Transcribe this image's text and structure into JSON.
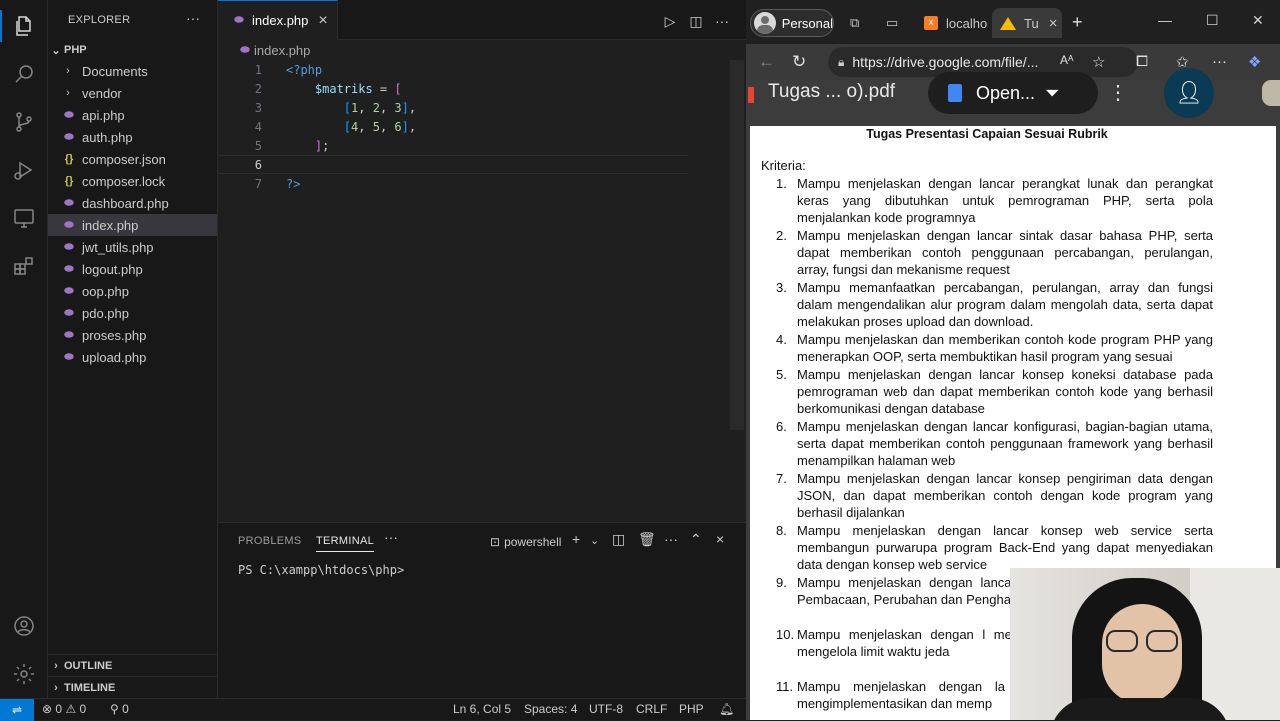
{
  "vscode": {
    "explorer_title": "EXPLORER",
    "more_glyph": "···",
    "root_folder": "PHP",
    "tree": [
      {
        "label": "Documents",
        "kind": "folder"
      },
      {
        "label": "vendor",
        "kind": "folder"
      },
      {
        "label": "api.php",
        "kind": "php"
      },
      {
        "label": "auth.php",
        "kind": "php"
      },
      {
        "label": "composer.json",
        "kind": "json"
      },
      {
        "label": "composer.lock",
        "kind": "json"
      },
      {
        "label": "dashboard.php",
        "kind": "php"
      },
      {
        "label": "index.php",
        "kind": "php",
        "selected": true
      },
      {
        "label": "jwt_utils.php",
        "kind": "php"
      },
      {
        "label": "logout.php",
        "kind": "php"
      },
      {
        "label": "oop.php",
        "kind": "php"
      },
      {
        "label": "pdo.php",
        "kind": "php"
      },
      {
        "label": "proses.php",
        "kind": "php"
      },
      {
        "label": "upload.php",
        "kind": "php"
      }
    ],
    "outline_label": "OUTLINE",
    "timeline_label": "TIMELINE",
    "tab_label": "index.php",
    "breadcrumb": "index.php",
    "code_lines": [
      {
        "n": "1",
        "text": "<?php"
      },
      {
        "n": "2",
        "text": "    $matriks = ["
      },
      {
        "n": "3",
        "text": "        [1, 2, 3],"
      },
      {
        "n": "4",
        "text": "        [4, 5, 6],"
      },
      {
        "n": "5",
        "text": "    ];"
      },
      {
        "n": "6",
        "text": ""
      },
      {
        "n": "7",
        "text": "?>"
      }
    ],
    "panel": {
      "tabs": [
        "PROBLEMS",
        "TERMINAL"
      ],
      "active_tab": "TERMINAL",
      "shell": "powershell",
      "prompt": "PS C:\\xampp\\htdocs\\php>"
    },
    "status": {
      "errors": "0",
      "warnings": "0",
      "ports": "0",
      "position": "Ln 6, Col 5",
      "spaces": "Spaces: 4",
      "encoding": "UTF-8",
      "eol": "CRLF",
      "language": "PHP"
    },
    "accent": "#0078d4"
  },
  "browser": {
    "profile": "Personal",
    "tabs": [
      {
        "label": "localho",
        "icon": "xampp-icon"
      },
      {
        "label": "Tu",
        "icon": "google-drive-icon",
        "active": true
      }
    ],
    "url": "https://drive.google.com/file/...",
    "drive": {
      "doc_name": "Tugas ... o).pdf",
      "open_label": "Open..."
    },
    "document": {
      "heading": "Tugas Presentasi Capaian Sesuai Rubrik",
      "criteria_label": "Kriteria:",
      "items": [
        {
          "num": "1.",
          "text": "Mampu menjelaskan dengan lancar  perangkat lunak dan perangkat keras yang dibutuhkan untuk pemrograman PHP, serta pola menjalankan kode programnya"
        },
        {
          "num": "2.",
          "text": "Mampu menjelaskan dengan lancar sintak dasar bahasa PHP, serta dapat memberikan contoh penggunaan percabangan, perulangan, array, fungsi dan mekanisme request"
        },
        {
          "num": "3.",
          "text": "Mampu memanfaatkan percabangan, perulangan, array dan fungsi dalam mengendalikan alur program dalam mengolah data, serta dapat melakukan proses upload dan download."
        },
        {
          "num": "4.",
          "text": "Mampu menjelaskan dan memberikan contoh kode program PHP yang menerapkan OOP, serta membuktikan hasil program yang sesuai"
        },
        {
          "num": "5.",
          "text": "Mampu menjelaskan dengan lancar konsep koneksi database pada pemrograman web dan dapat memberikan contoh kode yang berhasil berkomunikasi dengan database"
        },
        {
          "num": "6.",
          "text": "Mampu menjelaskan dengan lancar konfigurasi, bagian-bagian utama, serta dapat memberikan contoh penggunaan framework yang berhasil menampilkan halaman web"
        },
        {
          "num": "7.",
          "text": "Mampu menjelaskan dengan lancar konsep pengiriman data dengan JSON, dan dapat memberikan contoh dengan kode program yang berhasil dijalankan"
        },
        {
          "num": "8.",
          "text": "Mampu menjelaskan dengan lancar konsep web service serta membangun purwarupa program Back-End yang dapat menyediakan data dengan konsep web service"
        },
        {
          "num": "9.",
          "text": "Mampu menjelaskan dengan lancar membangun web service yang Pembacaan, Perubahan dan Pengha"
        },
        {
          "num": "10.",
          "text": "Mampu menjelaskan dengan l mengimplementasikan ke dalam be mengelola limit waktu jeda"
        },
        {
          "num": "11.",
          "text": "Mampu menjelaskan dengan la menyampaikan analisis penyel mengimplementasikan dan memp"
        }
      ]
    }
  }
}
